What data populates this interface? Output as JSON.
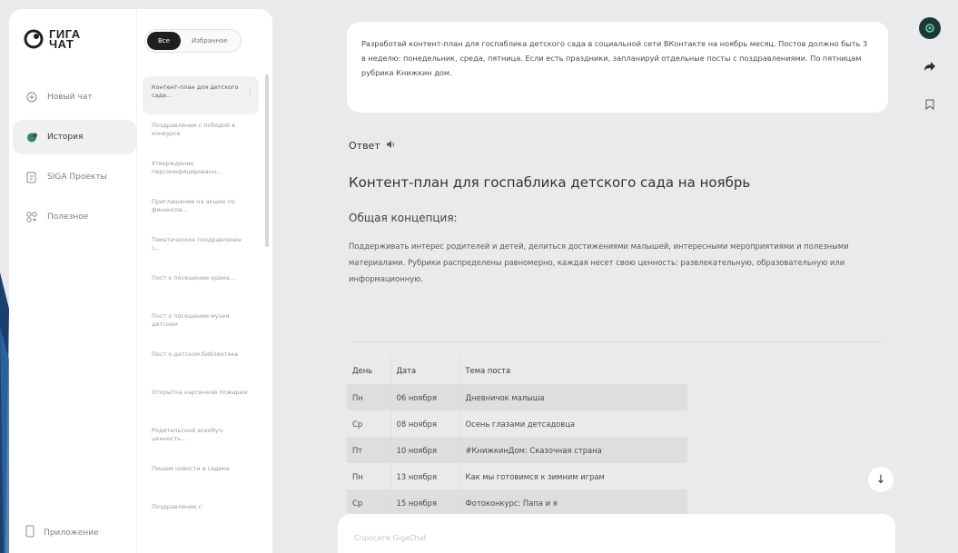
{
  "app": {
    "logo_text": "ГИГА ЧАТ"
  },
  "nav": {
    "items": [
      {
        "label": "Новый чат",
        "icon": "plus-circle-icon",
        "active": false
      },
      {
        "label": "История",
        "icon": "chat-history-icon",
        "active": true
      },
      {
        "label": "SIGA Проекты",
        "icon": "projects-icon",
        "active": false
      },
      {
        "label": "Полезное",
        "icon": "grid-icon",
        "active": false
      }
    ],
    "bottom_label": "Приложение"
  },
  "history": {
    "filters": [
      {
        "label": "Все",
        "active": true
      },
      {
        "label": "Избранное",
        "active": false
      }
    ],
    "items": [
      "Контент-план для детского сада...",
      "Поздравление с победой в конкурсе",
      "Утверждение персонифицированн...",
      "Приглашение на акцию по финансов...",
      "Тематическое поздравление с...",
      "Пост о посещении храма...",
      "Пост о посещении музея детским",
      "Пост о детском библиотеке",
      "Открытка картинкой пожарам",
      "Родительский всеобуч: ценность...",
      "Пишем новости в садике",
      "Поздравление с"
    ]
  },
  "chat": {
    "user_message": "Разработай контент-план для госпаблика детского сада в социальной сети ВКонтакте на ноябрь месяц. Постов должно быть 3 в неделю: понедельник, среда, пятница. Если есть праздники, запланируй отдельные посты с поздравлениями. По пятницам рубрика Книжкин дом.",
    "answer_label": "Ответ",
    "answer_title": "Контент-план для госпаблика детского сада на ноябрь",
    "section_title": "Общая концепция:",
    "concept": "Поддерживать интерес родителей и детей, делиться достижениями малышей, интересными мероприятиями и полезными материалами. Рубрики распределены равномерно, каждая несет свою ценность: развлекательную, образовательную или информационную.",
    "table": {
      "headers": [
        "День",
        "Дата",
        "Тема поста"
      ],
      "rows": [
        [
          "Пн",
          "06 ноября",
          "Дневничок малыша"
        ],
        [
          "Ср",
          "08 ноября",
          "Осень глазами детсадовца"
        ],
        [
          "Пт",
          "10 ноября",
          "#КнижкинДом: Сказочная страна"
        ],
        [
          "Пн",
          "13 ноября",
          "Как мы готовимся к зимним играм"
        ],
        [
          "Ср",
          "15 ноября",
          "Фотоконкурс: Папа и я"
        ]
      ]
    },
    "input_placeholder": "Спросите GigaChat"
  },
  "colors": {
    "accent_dark": "#1f1f1f",
    "avatar": "#1b3a33",
    "active_bg": "#eef0f1"
  }
}
